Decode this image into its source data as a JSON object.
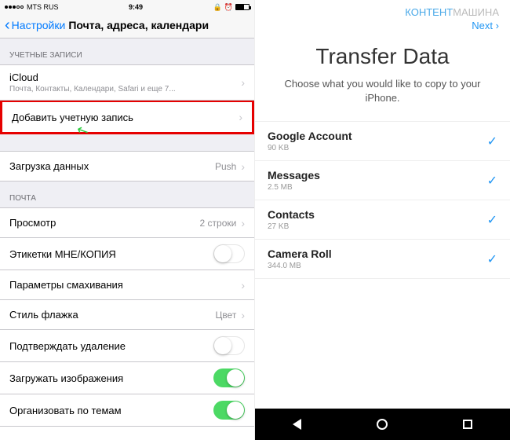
{
  "left": {
    "status": {
      "carrier": "MTS RUS",
      "time": "9:49"
    },
    "nav": {
      "back": "Настройки",
      "title": "Почта, адреса, календари"
    },
    "section_accounts": "УЧЕТНЫЕ ЗАПИСИ",
    "icloud": {
      "title": "iCloud",
      "sub": "Почта, Контакты, Календари, Safari и еще 7..."
    },
    "add_account": "Добавить учетную запись",
    "fetch": {
      "label": "Загрузка данных",
      "value": "Push"
    },
    "section_mail": "ПОЧТА",
    "preview": {
      "label": "Просмотр",
      "value": "2 строки"
    },
    "cc_label": "Этикетки МНЕ/КОПИЯ",
    "swipe": "Параметры смахивания",
    "flag": {
      "label": "Стиль флажка",
      "value": "Цвет"
    },
    "confirm_delete": "Подтверждать удаление",
    "load_images": "Загружать изображения",
    "organize_thread": "Организовать по темам"
  },
  "right": {
    "brand1": "КОНТЕНТ",
    "brand2": "МАШИНА",
    "next": "Next",
    "title": "Transfer Data",
    "subtitle": "Choose what you would like to copy to your iPhone.",
    "items": [
      {
        "title": "Google Account",
        "size": "90 KB"
      },
      {
        "title": "Messages",
        "size": "2.5 MB"
      },
      {
        "title": "Contacts",
        "size": "27 KB"
      },
      {
        "title": "Camera Roll",
        "size": "344.0 MB"
      }
    ]
  }
}
